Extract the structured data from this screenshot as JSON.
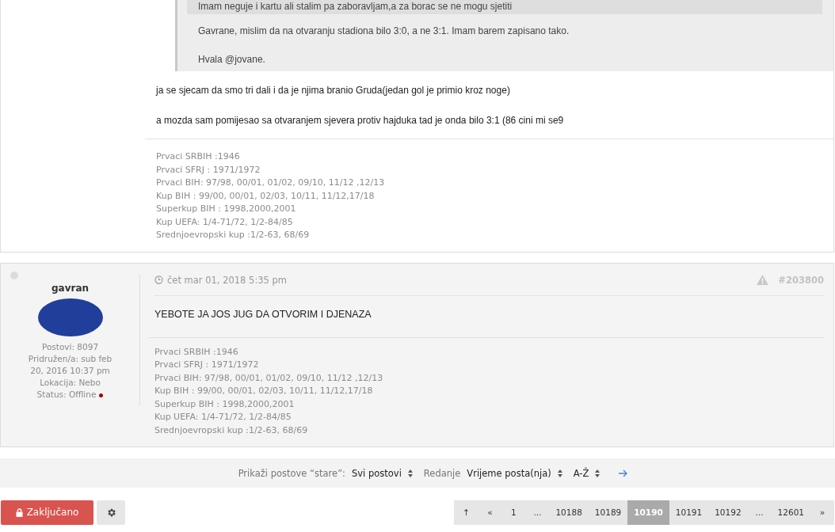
{
  "previous_post": {
    "quote": {
      "nested_quote": "Imam neguje i kartu ali stalim pa zaboravljam,a za borac se ne mogu sjetiti",
      "paragraphs": [
        "Gavrane, mislim da na otvaranju stadiona bilo 3:0, a ne 3:1. Imam barem zapisano tako.",
        "Hvala @jovane."
      ]
    },
    "paragraphs": [
      "ja se sjecam da smo tri dali i da je njima branio Gruda(jedan gol je primio kroz noge)",
      "a mozda sam pomijesao sa otvaranjem sjevera protiv hajduka tad je onda bilo 3:1 (86 cini mi se9"
    ],
    "signature": [
      "Prvaci SRBIH :1946",
      "Prvaci SFRJ : 1971/1972",
      "Prvaci BIH: 97/98, 00/01, 01/02, 09/10, 11/12 ,12/13",
      "Kup BIH : 99/00, 00/01, 02/03, 10/11, 11/12,17/18",
      "Superkup BIH : 1998,2000,2001",
      "Kup UEFA: 1/4-71/72, 1/2-84/85",
      "Srednjoevropski kup :1/2-63, 68/69"
    ]
  },
  "post": {
    "author": "gavran",
    "online": false,
    "profile": [
      "Postovi: 8097",
      "Pridružen/a: sub feb 20, 2016 10:37 pm",
      "Lokacija: Nebo"
    ],
    "status": "Status: Offline",
    "date": "čet mar 01, 2018 5:35 pm",
    "post_id": "#203800",
    "body": "YEBOTE JA JOS JUG DA OTVORIM I DJENAZA",
    "signature": [
      "Prvaci SRBIH :1946",
      "Prvaci SFRJ : 1971/1972",
      "Prvaci BIH: 97/98, 00/01, 01/02, 09/10, 11/12 ,12/13",
      "Kup BIH : 99/00, 00/01, 02/03, 10/11, 11/12,17/18",
      "Superkup BIH : 1998,2000,2001",
      "Kup UEFA: 1/4-71/72, 1/2-84/85",
      "Srednjoevropski kup :1/2-63, 68/69"
    ]
  },
  "sort_bar": {
    "show_label": "Prikaži postove “stare”:",
    "show_value": "Svi postovi",
    "sort_label": "Redanje",
    "sort_value": "Vrijeme posta(nja)",
    "direction": "A-Ž"
  },
  "locked_button": "Zaključano",
  "pagination": [
    {
      "label": "↑",
      "selected": false
    },
    {
      "label": "«",
      "selected": false
    },
    {
      "label": "1",
      "selected": false
    },
    {
      "label": "...",
      "selected": false
    },
    {
      "label": "10188",
      "selected": false
    },
    {
      "label": "10189",
      "selected": false
    },
    {
      "label": "10190",
      "selected": true
    },
    {
      "label": "10191",
      "selected": false
    },
    {
      "label": "10192",
      "selected": false
    },
    {
      "label": "...",
      "selected": false
    },
    {
      "label": "12601",
      "selected": false
    },
    {
      "label": "»",
      "selected": false
    }
  ]
}
